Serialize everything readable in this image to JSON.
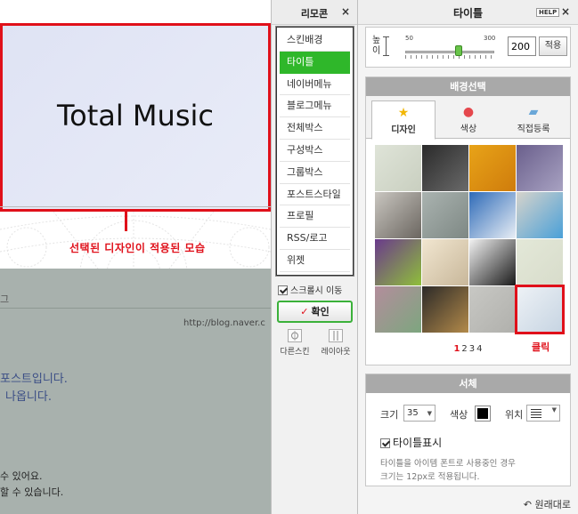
{
  "preview": {
    "title_text": "Total Music",
    "caption": "선택된 디자인이 적용된 모습",
    "fragment_go": "그",
    "url": "http://blog.naver.c",
    "post_line1": "포스트입니다.",
    "post_line2": "나옵니다.",
    "text_line1": "수 있어요.",
    "text_line2": "할 수 있습니다."
  },
  "remote": {
    "title": "리모콘",
    "close": "×",
    "items": [
      {
        "label": "스킨배경",
        "active": false
      },
      {
        "label": "타이틀",
        "active": true
      },
      {
        "label": "네이버메뉴",
        "active": false
      },
      {
        "label": "블로그메뉴",
        "active": false
      },
      {
        "label": "전체박스",
        "active": false
      },
      {
        "label": "구성박스",
        "active": false
      },
      {
        "label": "그룹박스",
        "active": false
      },
      {
        "label": "포스트스타일",
        "active": false
      },
      {
        "label": "프로필",
        "active": false
      },
      {
        "label": "RSS/로고",
        "active": false
      },
      {
        "label": "위젯",
        "active": false
      }
    ],
    "scroll_move_label": "스크롤시 이동",
    "confirm_check": "✓",
    "confirm_label": "확인",
    "tool_other_skin": "다른스킨",
    "tool_layout": "레이아웃"
  },
  "panel": {
    "title": "타이틀",
    "help": "HELP",
    "close": "×",
    "height_label": "높이",
    "slider_min": "50",
    "slider_max": "300",
    "slider_value": 200,
    "height_value": "200",
    "apply": "적용",
    "bg_title": "배경선택",
    "tabs": [
      {
        "label": "디자인",
        "icon": "star-icon",
        "active": true
      },
      {
        "label": "색상",
        "icon": "color-wheel-icon",
        "active": false
      },
      {
        "label": "직접등록",
        "icon": "folder-upload-icon",
        "active": false
      }
    ],
    "thumbnails": [
      {
        "name": "balloon",
        "colors": [
          "#dfe4d8",
          "#c9cfc0"
        ],
        "selected": false
      },
      {
        "name": "dot-map",
        "colors": [
          "#2a2a2a",
          "#6a6a6a"
        ],
        "selected": false
      },
      {
        "name": "orange-bubbles",
        "colors": [
          "#e8a318",
          "#cf7c0c"
        ],
        "selected": false
      },
      {
        "name": "night-tower",
        "colors": [
          "#6a5f8c",
          "#a8a2c2"
        ],
        "selected": false
      },
      {
        "name": "old-car",
        "colors": [
          "#c9c6c0",
          "#6b6660"
        ],
        "selected": false
      },
      {
        "name": "sky-clouds",
        "colors": [
          "#aab3b0",
          "#7e8884"
        ],
        "selected": false
      },
      {
        "name": "santorini",
        "colors": [
          "#2f6bb8",
          "#e8eef5"
        ],
        "selected": false
      },
      {
        "name": "photo-frame",
        "colors": [
          "#d6d3cb",
          "#4aa0d8"
        ],
        "selected": false
      },
      {
        "name": "purple-leaves",
        "colors": [
          "#6a3a8c",
          "#8fbf3a"
        ],
        "selected": false
      },
      {
        "name": "cartoon-boy",
        "colors": [
          "#f1e6d0",
          "#c8b79a"
        ],
        "selected": false
      },
      {
        "name": "barcode",
        "colors": [
          "#f2f2f2",
          "#1a1a1a"
        ],
        "selected": false
      },
      {
        "name": "pastel",
        "colors": [
          "#e3e8d8",
          "#d8dccb"
        ],
        "selected": false
      },
      {
        "name": "blur-color",
        "colors": [
          "#b38d9c",
          "#7da67f"
        ],
        "selected": false
      },
      {
        "name": "candles",
        "colors": [
          "#2c2a28",
          "#b38a4a"
        ],
        "selected": false
      },
      {
        "name": "gray-texture",
        "colors": [
          "#c8c8c4",
          "#b0b0ac"
        ],
        "selected": false
      },
      {
        "name": "stationery",
        "colors": [
          "#eef2f6",
          "#c6d4e2"
        ],
        "selected": true
      }
    ],
    "pages": [
      {
        "label": "1",
        "active": true
      },
      {
        "label": "2",
        "active": false
      },
      {
        "label": "3",
        "active": false
      },
      {
        "label": "4",
        "active": false
      }
    ],
    "click_label": "클릭",
    "font_title": "서체",
    "size_label": "크기",
    "size_value": "35",
    "color_label": "색상",
    "text_color": "#000000",
    "position_label": "위치",
    "show_title_label": "타이틀표시",
    "note_line1": "타이틀을 아이템 폰트로 사용중인 경우",
    "note_line2": "크기는 12px로 적용됩니다.",
    "reset_label": "원래대로"
  },
  "colors": {
    "accent_red": "#e0101a",
    "active_green": "#2fb72a",
    "link_blue": "#3b4e86"
  }
}
